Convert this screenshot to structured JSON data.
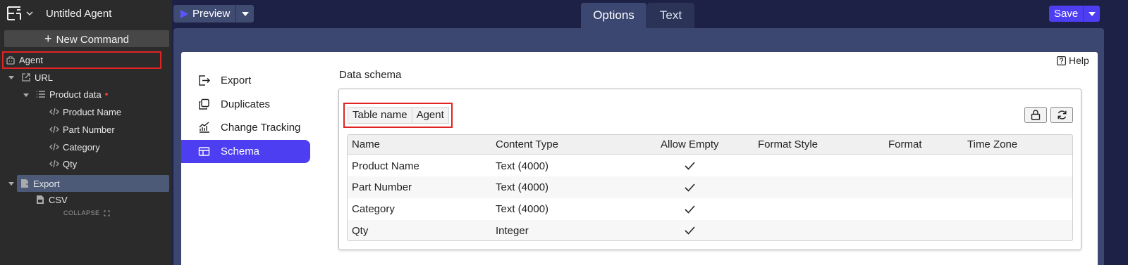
{
  "app": {
    "agent_title": "Untitled Agent",
    "new_command_label": "New Command",
    "collapse_label": "COLLAPSE"
  },
  "tree": {
    "agent": "Agent",
    "url": "URL",
    "product_data": "Product data",
    "product_name": "Product Name",
    "part_number": "Part Number",
    "category": "Category",
    "qty": "Qty",
    "export": "Export",
    "csv": "CSV"
  },
  "topbar": {
    "preview_label": "Preview",
    "tabs": [
      "Options",
      "Text"
    ],
    "active_tab": "Options",
    "save_label": "Save"
  },
  "panel": {
    "help_label": "Help",
    "nav": [
      "Export",
      "Duplicates",
      "Change Tracking",
      "Schema"
    ],
    "active_nav": "Schema",
    "schema_title": "Data schema",
    "table_name_label": "Table name",
    "table_name_value": "Agent"
  },
  "grid": {
    "columns": [
      "Name",
      "Content Type",
      "Allow Empty",
      "Format Style",
      "Format",
      "Time Zone"
    ],
    "rows": [
      {
        "name": "Product Name",
        "content_type": "Text (4000)",
        "allow_empty": true
      },
      {
        "name": "Part Number",
        "content_type": "Text (4000)",
        "allow_empty": true
      },
      {
        "name": "Category",
        "content_type": "Text (4000)",
        "allow_empty": true
      },
      {
        "name": "Qty",
        "content_type": "Integer",
        "allow_empty": true
      }
    ]
  },
  "colors": {
    "accent": "#4d3ef2",
    "sidebar_bg": "#2b2b2b",
    "topbar_bg": "#1d2145",
    "highlight": "#e02424"
  }
}
